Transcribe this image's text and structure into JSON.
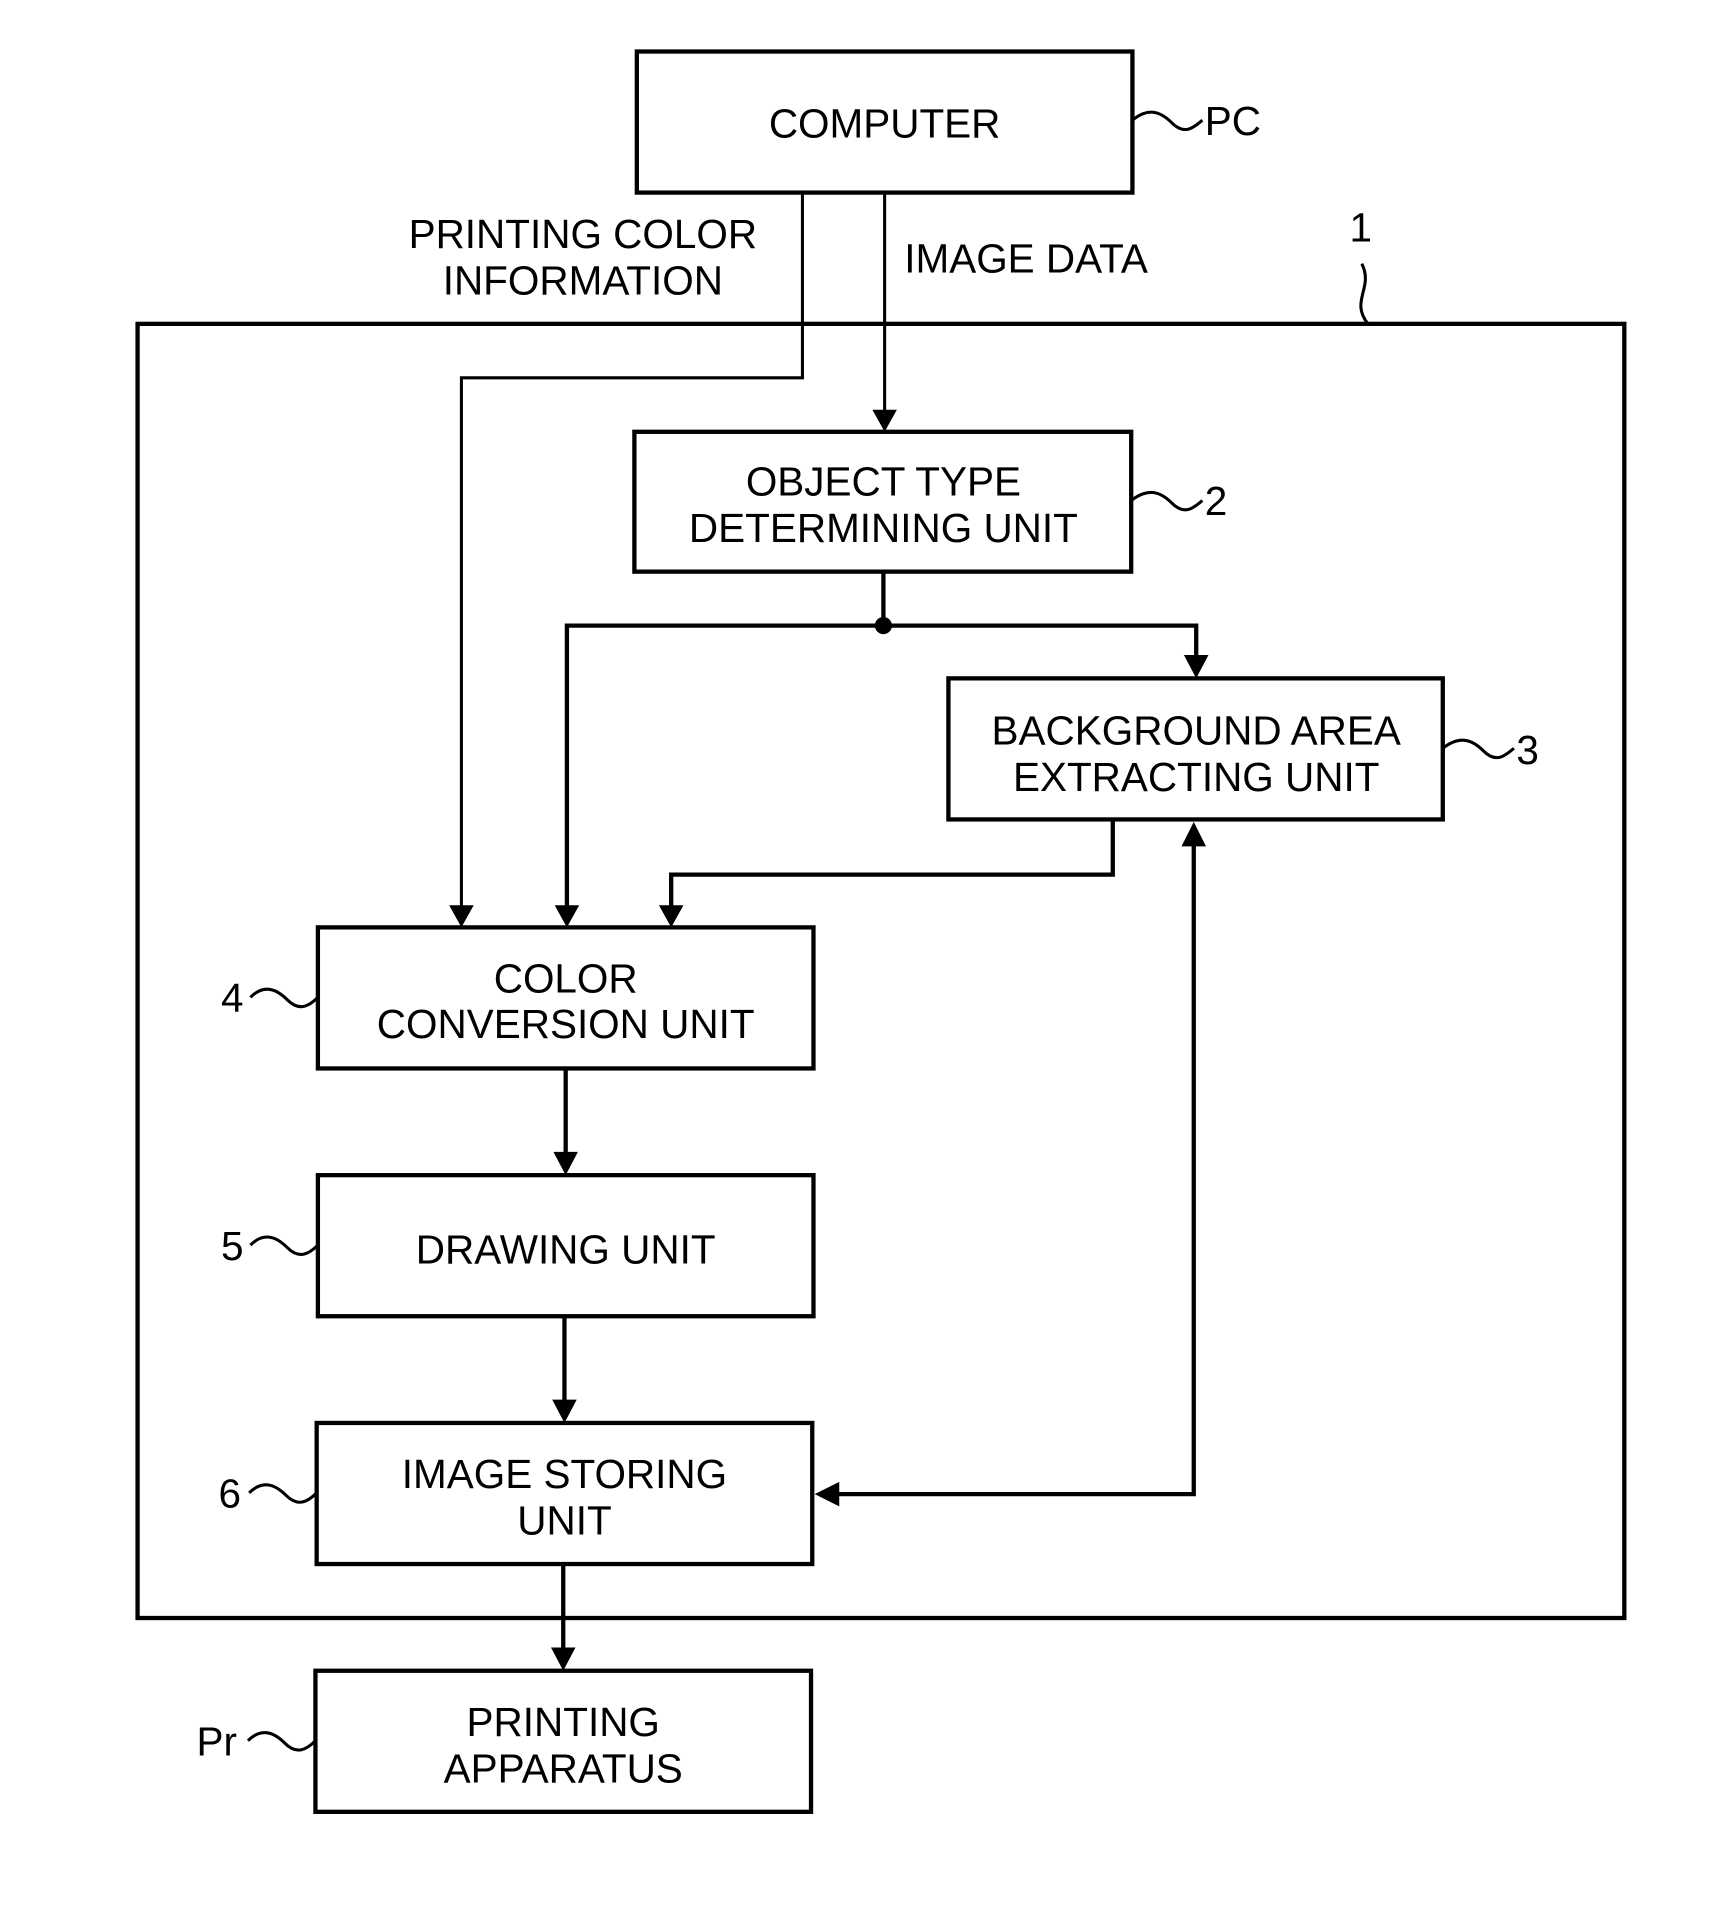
{
  "diagram": {
    "outer_block": {
      "ref": "1"
    },
    "computer": {
      "lines": [
        "COMPUTER"
      ],
      "ref": "PC"
    },
    "object_type": {
      "lines": [
        "OBJECT TYPE",
        "DETERMINING UNIT"
      ],
      "ref": "2"
    },
    "background": {
      "lines": [
        "BACKGROUND AREA",
        "EXTRACTING UNIT"
      ],
      "ref": "3"
    },
    "color_conversion": {
      "lines": [
        "COLOR",
        "CONVERSION UNIT"
      ],
      "ref": "4"
    },
    "drawing": {
      "lines": [
        "DRAWING UNIT"
      ],
      "ref": "5"
    },
    "image_storing": {
      "lines": [
        "IMAGE STORING",
        "UNIT"
      ],
      "ref": "6"
    },
    "printing": {
      "lines": [
        "PRINTING",
        "APPARATUS"
      ],
      "ref": "Pr"
    },
    "edge_labels": {
      "printing_color_info": [
        "PRINTING COLOR",
        "INFORMATION"
      ],
      "image_data": "IMAGE DATA"
    }
  }
}
